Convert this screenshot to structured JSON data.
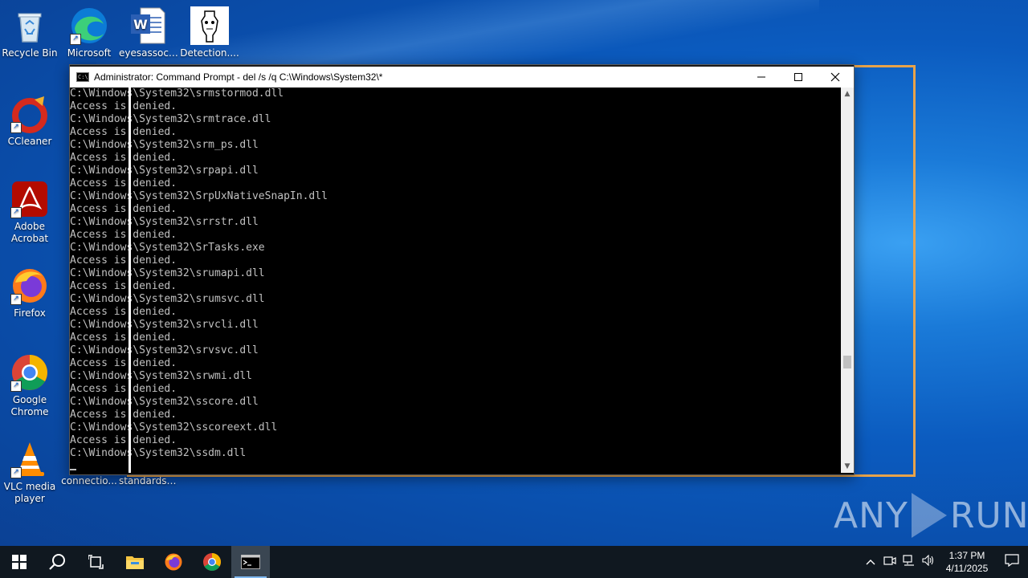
{
  "desktop": {
    "icons": [
      {
        "label": "Recycle Bin"
      },
      {
        "label": "Microsoft Edge"
      },
      {
        "label": "eyesassoci..."
      },
      {
        "label": "Detection...."
      },
      {
        "label": "CCleaner"
      },
      {
        "label": "Adobe Acrobat"
      },
      {
        "label": "Firefox"
      },
      {
        "label": "Google Chrome"
      },
      {
        "label": "VLC media player"
      },
      {
        "label": "connectio..."
      },
      {
        "label": "standardsc..."
      }
    ]
  },
  "cmd_window": {
    "title": "Administrator: Command Prompt - del  /s /q C:\\Windows\\System32\\*",
    "minimize": "—",
    "maximize": "☐",
    "close": "✕",
    "lines": [
      "C:\\Windows\\System32\\srmstormod.dll",
      "Access is denied.",
      "C:\\Windows\\System32\\srmtrace.dll",
      "Access is denied.",
      "C:\\Windows\\System32\\srm_ps.dll",
      "Access is denied.",
      "C:\\Windows\\System32\\srpapi.dll",
      "Access is denied.",
      "C:\\Windows\\System32\\SrpUxNativeSnapIn.dll",
      "Access is denied.",
      "C:\\Windows\\System32\\srrstr.dll",
      "Access is denied.",
      "C:\\Windows\\System32\\SrTasks.exe",
      "Access is denied.",
      "C:\\Windows\\System32\\srumapi.dll",
      "Access is denied.",
      "C:\\Windows\\System32\\srumsvc.dll",
      "Access is denied.",
      "C:\\Windows\\System32\\srvcli.dll",
      "Access is denied.",
      "C:\\Windows\\System32\\srvsvc.dll",
      "Access is denied.",
      "C:\\Windows\\System32\\srwmi.dll",
      "Access is denied.",
      "C:\\Windows\\System32\\sscore.dll",
      "Access is denied.",
      "C:\\Windows\\System32\\sscoreext.dll",
      "Access is denied.",
      "C:\\Windows\\System32\\ssdm.dll"
    ]
  },
  "watermark": {
    "left": "ANY",
    "right": "RUN"
  },
  "taskbar": {
    "time": "1:37 PM",
    "date": "4/11/2025"
  },
  "colors": {
    "highlight": "#e8a34a",
    "console_text": "#c0c0c0",
    "taskbar": "#101820"
  }
}
